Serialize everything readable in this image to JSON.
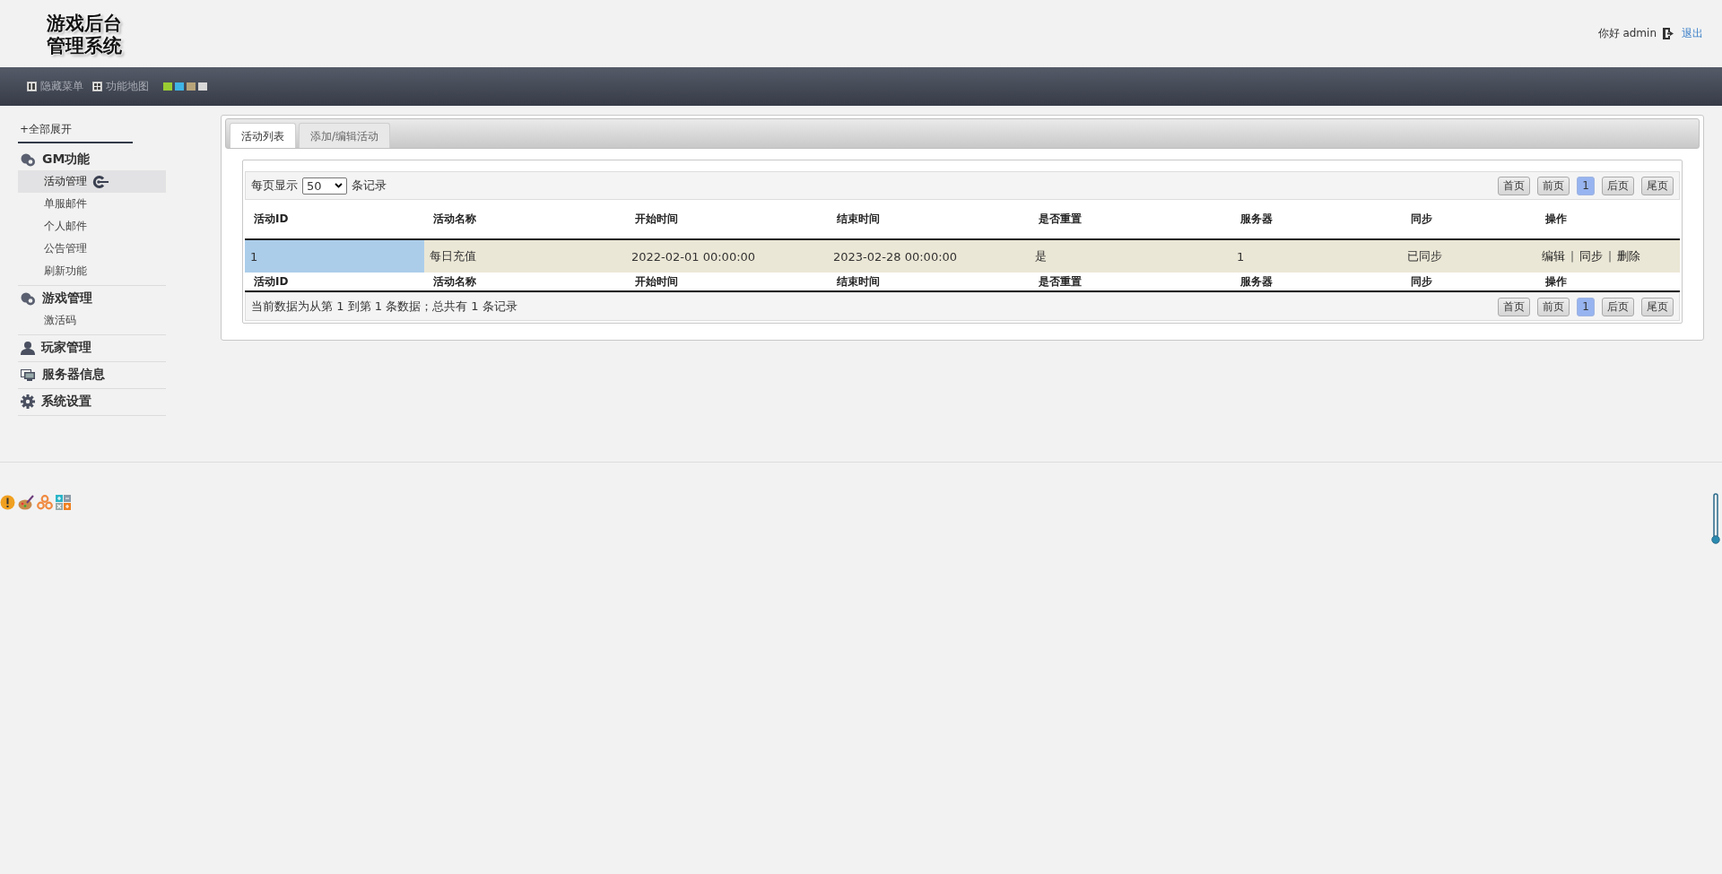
{
  "header": {
    "logo_lines": [
      "游戏后台",
      "管理系统"
    ],
    "greeting": "你好 admin",
    "logout": "退出"
  },
  "toolbar": {
    "items": [
      {
        "kind": "hide",
        "label": "隐藏菜单"
      },
      {
        "kind": "map",
        "label": "功能地图"
      }
    ],
    "themes": [
      {
        "color": "#9acd32"
      },
      {
        "color": "#3fb4e6"
      },
      {
        "color": "#b8a47a"
      },
      {
        "color": "#d8d8d8"
      }
    ]
  },
  "sidebar": {
    "expand_all": "+全部展开",
    "sections": [
      {
        "kind": "gm",
        "title": "GM功能",
        "items": [
          {
            "label": "活动管理",
            "selected": true
          },
          {
            "label": "单服邮件",
            "selected": false
          },
          {
            "label": "个人邮件",
            "selected": false
          },
          {
            "label": "公告管理",
            "selected": false
          },
          {
            "label": "刷新功能",
            "selected": false
          }
        ]
      },
      {
        "kind": "gm",
        "title": "游戏管理",
        "items": [
          {
            "label": "激活码",
            "selected": false
          }
        ]
      },
      {
        "kind": "user",
        "title": "玩家管理"
      },
      {
        "kind": "server",
        "title": "服务器信息"
      },
      {
        "kind": "gear",
        "title": "系统设置"
      }
    ]
  },
  "tabs": [
    {
      "label": "活动列表",
      "selected": true
    },
    {
      "label": "添加/编辑活动",
      "selected": false
    }
  ],
  "table": {
    "length_prefix": "每页显示",
    "length_value": "50",
    "length_suffix": "条记录",
    "pager": [
      {
        "label": "首页",
        "selected": false
      },
      {
        "label": "前页",
        "selected": false
      },
      {
        "label": "1",
        "selected": true
      },
      {
        "label": "后页",
        "selected": false
      },
      {
        "label": "尾页",
        "selected": false
      }
    ],
    "columns": [
      "活动ID",
      "活动名称",
      "开始时间",
      "结束时间",
      "是否重置",
      "服务器",
      "同步",
      "操作"
    ],
    "rows": [
      {
        "cells": [
          {
            "text": "1",
            "sorted": true
          },
          {
            "text": "每日充值",
            "sorted": false
          },
          {
            "text": "2022-02-01 00:00:00",
            "sorted": false
          },
          {
            "text": "2023-02-28 00:00:00",
            "sorted": false
          },
          {
            "text": "是",
            "sorted": false
          },
          {
            "text": "1",
            "sorted": false
          },
          {
            "text": "已同步",
            "sorted": false
          }
        ],
        "actions": [
          {
            "kind": "link",
            "text": "编辑"
          },
          {
            "kind": "separator",
            "text": "|"
          },
          {
            "kind": "link",
            "text": "同步"
          },
          {
            "kind": "separator",
            "text": "|"
          },
          {
            "kind": "link",
            "text": "删除"
          }
        ]
      }
    ],
    "footer_columns": [
      "活动ID",
      "活动名称",
      "开始时间",
      "结束时间",
      "是否重置",
      "服务器",
      "同步",
      "操作"
    ],
    "bottom_pager": [
      {
        "label": "首页",
        "selected": false
      },
      {
        "label": "前页",
        "selected": false
      },
      {
        "label": "1",
        "selected": true
      },
      {
        "label": "后页",
        "selected": false
      },
      {
        "label": "尾页",
        "selected": false
      }
    ],
    "info": "当前数据为从第 1 到第 1 条数据；总共有 1 条记录"
  }
}
